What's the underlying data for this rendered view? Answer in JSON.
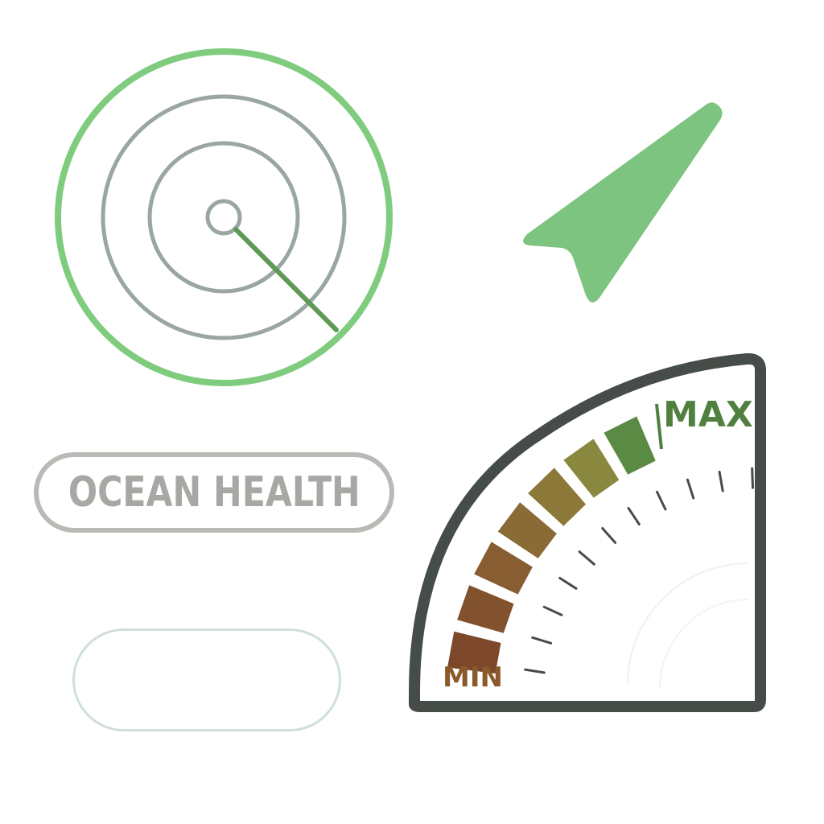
{
  "badge": {
    "label": "OCEAN HEALTH"
  },
  "gauge": {
    "min_label": "MIN",
    "max_label": "MAX",
    "segments_total": 7,
    "segment_colors": [
      "#7d472a",
      "#82512d",
      "#875d31",
      "#8a6a35",
      "#8c7839",
      "#8a873e",
      "#5a8a43"
    ]
  },
  "radar": {
    "ring_count": 3
  },
  "colors": {
    "radar_outer": "#7fcc7f",
    "radar_rings": "#9aa6a1",
    "radar_sweep": "#5f9a55",
    "arrow_fill": "#7cc47f",
    "gauge_frame": "#464c48",
    "min_text": "#8a5a2c",
    "max_text": "#4f8040",
    "badge_border": "#b9bab5",
    "badge_text": "#a7a8a3",
    "empty_pill_border": "#cfe0d6"
  },
  "icons": {
    "radar": "radar-icon",
    "navigation": "navigation-arrow-icon",
    "gauge": "gauge-meter-icon"
  }
}
